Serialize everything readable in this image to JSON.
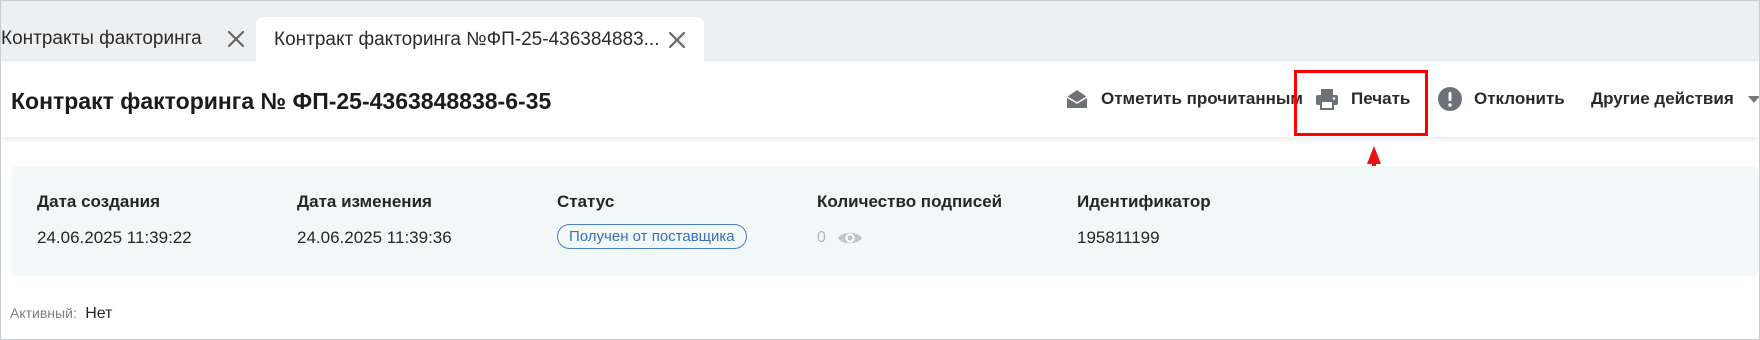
{
  "tabs": [
    {
      "label": "Контракты факторинга",
      "active": false
    },
    {
      "label": "Контракт факторинга №ФП-25-436384883...",
      "active": true
    }
  ],
  "header": {
    "title": "Контракт факторинга  № ФП-25-4363848838-6-35",
    "actions": {
      "mark_read": {
        "label": "Отметить прочитанным",
        "icon": "envelope-open-icon"
      },
      "print": {
        "label": "Печать",
        "icon": "printer-icon"
      },
      "reject": {
        "label": "Отклонить",
        "icon": "exclamation-circle-icon"
      },
      "other": {
        "label": "Другие действия",
        "icon": "caret-down-icon"
      }
    }
  },
  "info": {
    "created": {
      "label": "Дата создания",
      "value": "24.06.2025 11:39:22"
    },
    "modified": {
      "label": "Дата изменения",
      "value": "24.06.2025 11:39:36"
    },
    "status": {
      "label": "Статус",
      "value": "Получен от поставщика"
    },
    "signatures": {
      "label": "Количество подписей",
      "value": "0"
    },
    "identifier": {
      "label": "Идентификатор",
      "value": "195811199"
    }
  },
  "active": {
    "label": "Активный:",
    "value": "Нет"
  },
  "colors": {
    "tabbar_bg": "#eeeff1",
    "panel_bg": "#f2f8f7",
    "status_border": "#4a7fc4",
    "annotation": "#ff0000"
  }
}
